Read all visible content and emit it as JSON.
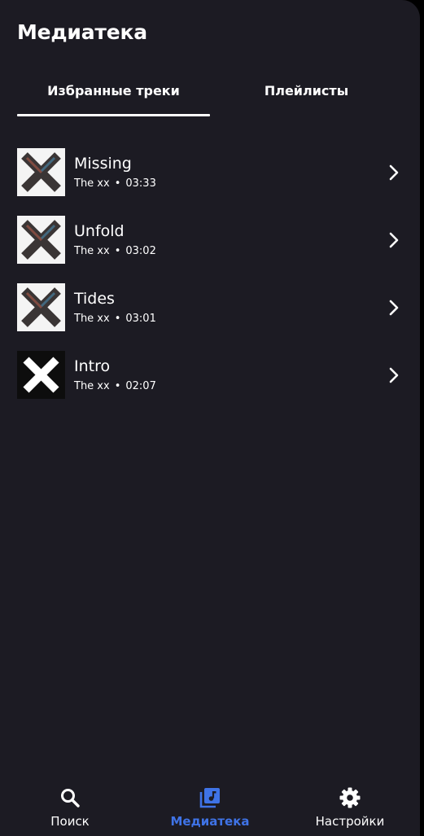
{
  "header": {
    "title": "Медиатека"
  },
  "tabs": [
    {
      "label": "Избранные треки",
      "active": true
    },
    {
      "label": "Плейлисты",
      "active": false
    }
  ],
  "tracks": [
    {
      "title": "Missing",
      "artist": "The xx",
      "duration": "03:33",
      "cover": "xx-coexist-cover"
    },
    {
      "title": "Unfold",
      "artist": "The xx",
      "duration": "03:02",
      "cover": "xx-coexist-cover"
    },
    {
      "title": "Tides",
      "artist": "The xx",
      "duration": "03:01",
      "cover": "xx-coexist-cover"
    },
    {
      "title": "Intro",
      "artist": "The xx",
      "duration": "02:07",
      "cover": "xx-debut-cover"
    }
  ],
  "meta_separator": "•",
  "bottom_nav": [
    {
      "label": "Поиск",
      "icon": "search-icon",
      "active": false
    },
    {
      "label": "Медиатека",
      "icon": "music-library-icon",
      "active": true
    },
    {
      "label": "Настройки",
      "icon": "gear-icon",
      "active": false
    }
  ],
  "colors": {
    "background": "#1c1b23",
    "accent": "#3f73e6",
    "text": "#ffffff"
  }
}
